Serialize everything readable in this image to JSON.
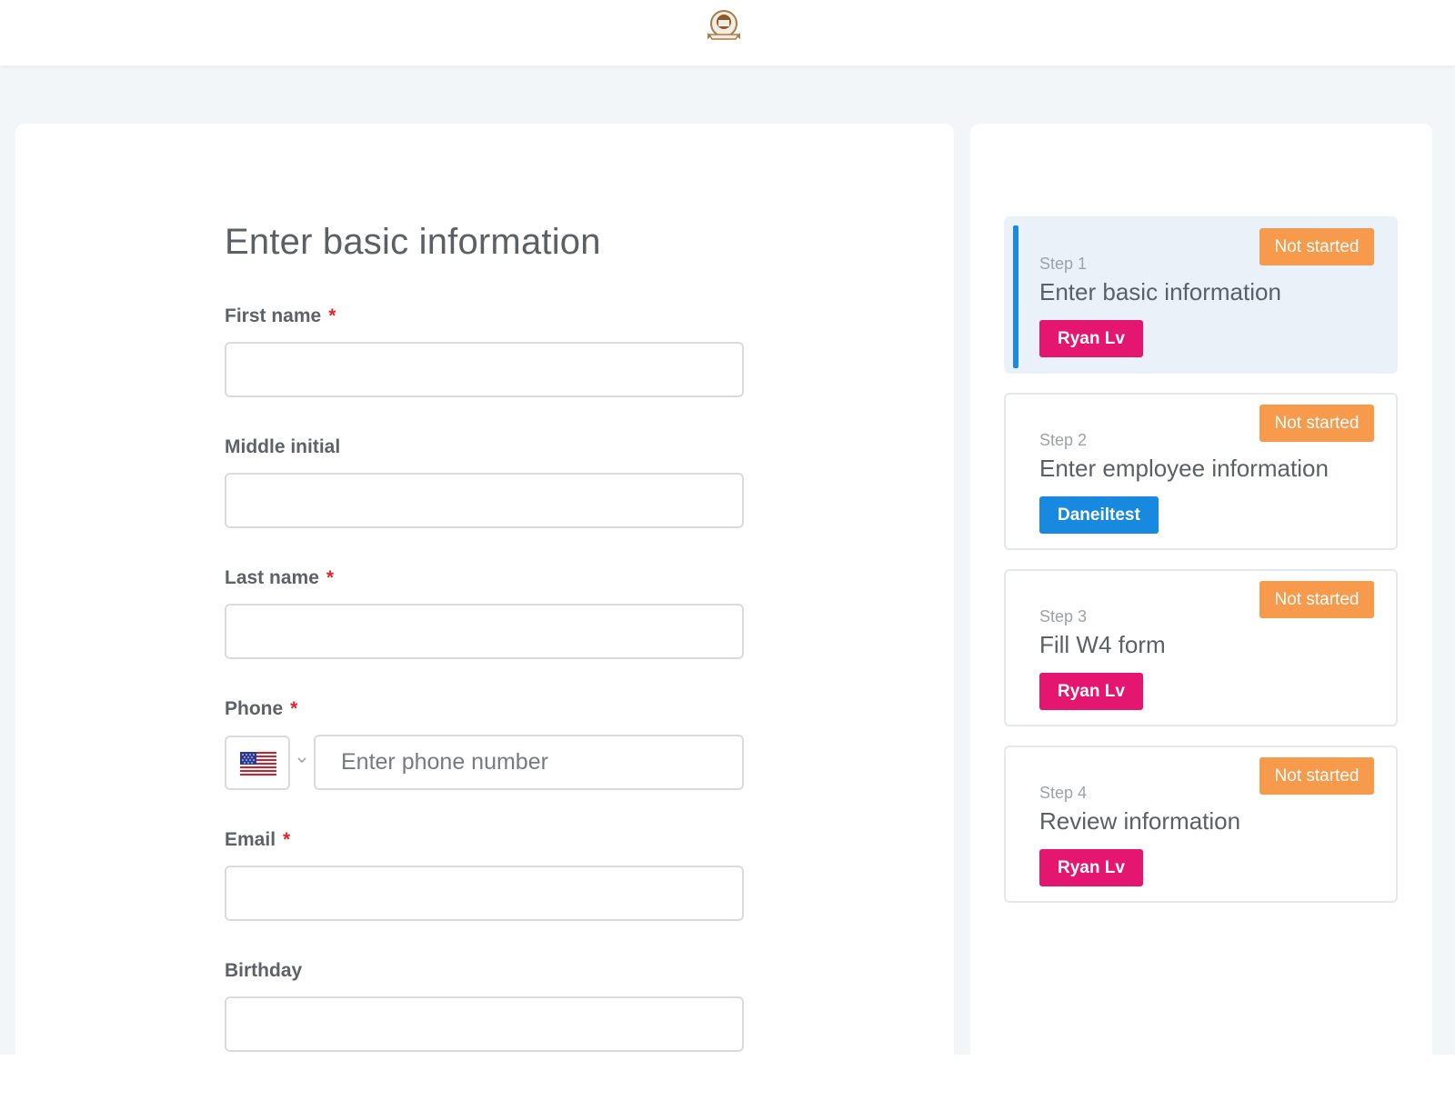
{
  "form": {
    "title": "Enter basic information",
    "fields": {
      "first_name": {
        "label": "First name",
        "required_mark": "*",
        "value": ""
      },
      "middle_initial": {
        "label": "Middle initial",
        "value": ""
      },
      "last_name": {
        "label": "Last name",
        "required_mark": "*",
        "value": ""
      },
      "phone": {
        "label": "Phone",
        "required_mark": "*",
        "placeholder": "Enter phone number",
        "country_flag": "us-flag-icon"
      },
      "email": {
        "label": "Email",
        "required_mark": "*",
        "value": ""
      },
      "birthday": {
        "label": "Birthday",
        "value": ""
      }
    }
  },
  "steps": [
    {
      "step": "Step 1",
      "title": "Enter basic information",
      "status": "Not started",
      "assignee": "Ryan Lv",
      "assignee_color": "#e5166f",
      "active": true
    },
    {
      "step": "Step 2",
      "title": "Enter employee information",
      "status": "Not started",
      "assignee": "Daneiltest",
      "assignee_color": "#178ae0",
      "active": false
    },
    {
      "step": "Step 3",
      "title": "Fill W4 form",
      "status": "Not started",
      "assignee": "Ryan Lv",
      "assignee_color": "#e5166f",
      "active": false
    },
    {
      "step": "Step 4",
      "title": "Review information",
      "status": "Not started",
      "assignee": "Ryan Lv",
      "assignee_color": "#e5166f",
      "active": false
    }
  ],
  "colors": {
    "status_badge": "#f79a4c",
    "active_accent": "#1a8be0",
    "required": "#e0262c"
  }
}
